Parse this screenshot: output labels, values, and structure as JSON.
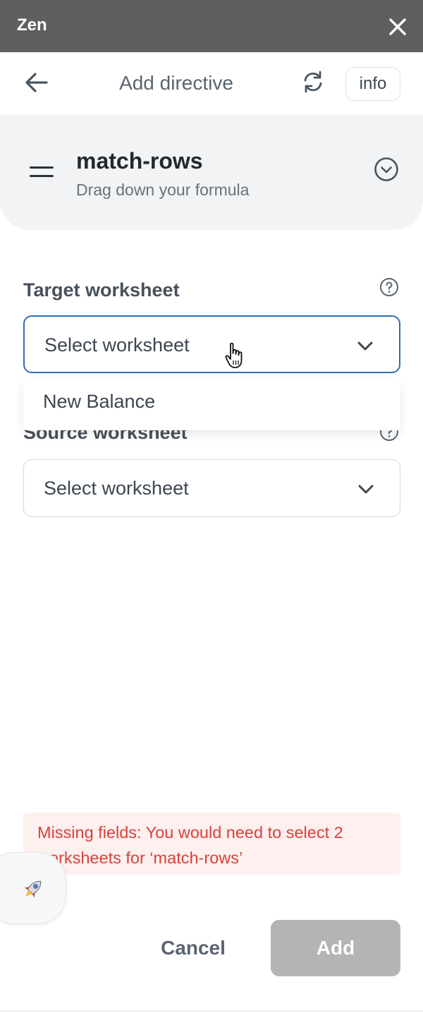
{
  "app": {
    "title": "Zen"
  },
  "header": {
    "title": "Add directive",
    "info_label": "info"
  },
  "directive": {
    "name": "match-rows",
    "description": "Drag down your formula"
  },
  "fields": {
    "target": {
      "label": "Target worksheet",
      "value": "Select worksheet"
    },
    "source": {
      "label": "Source worksheet",
      "value": "Select worksheet"
    }
  },
  "dropdown": {
    "options": [
      "New Balance"
    ]
  },
  "error": {
    "text": "Missing fields: You would need to select 2 worksheets for ‘match-rows’"
  },
  "actions": {
    "cancel_label": "Cancel",
    "add_label": "Add"
  },
  "colors": {
    "titlebar": "#5f5f5f",
    "accent_focus": "#2e6db4",
    "error_text": "#d9413b",
    "error_bg": "#fdf0ef",
    "disabled_button": "#b4b4b4"
  },
  "icons": {
    "close": "close-icon",
    "back": "arrow-left-icon",
    "refresh": "refresh-icon",
    "drag": "drag-handle-icon",
    "expand": "chevron-down-circle-icon",
    "help": "question-circle-icon",
    "chevron": "chevron-down-icon",
    "cursor": "hand-pointer-icon",
    "launcher": "rocket-icon"
  }
}
